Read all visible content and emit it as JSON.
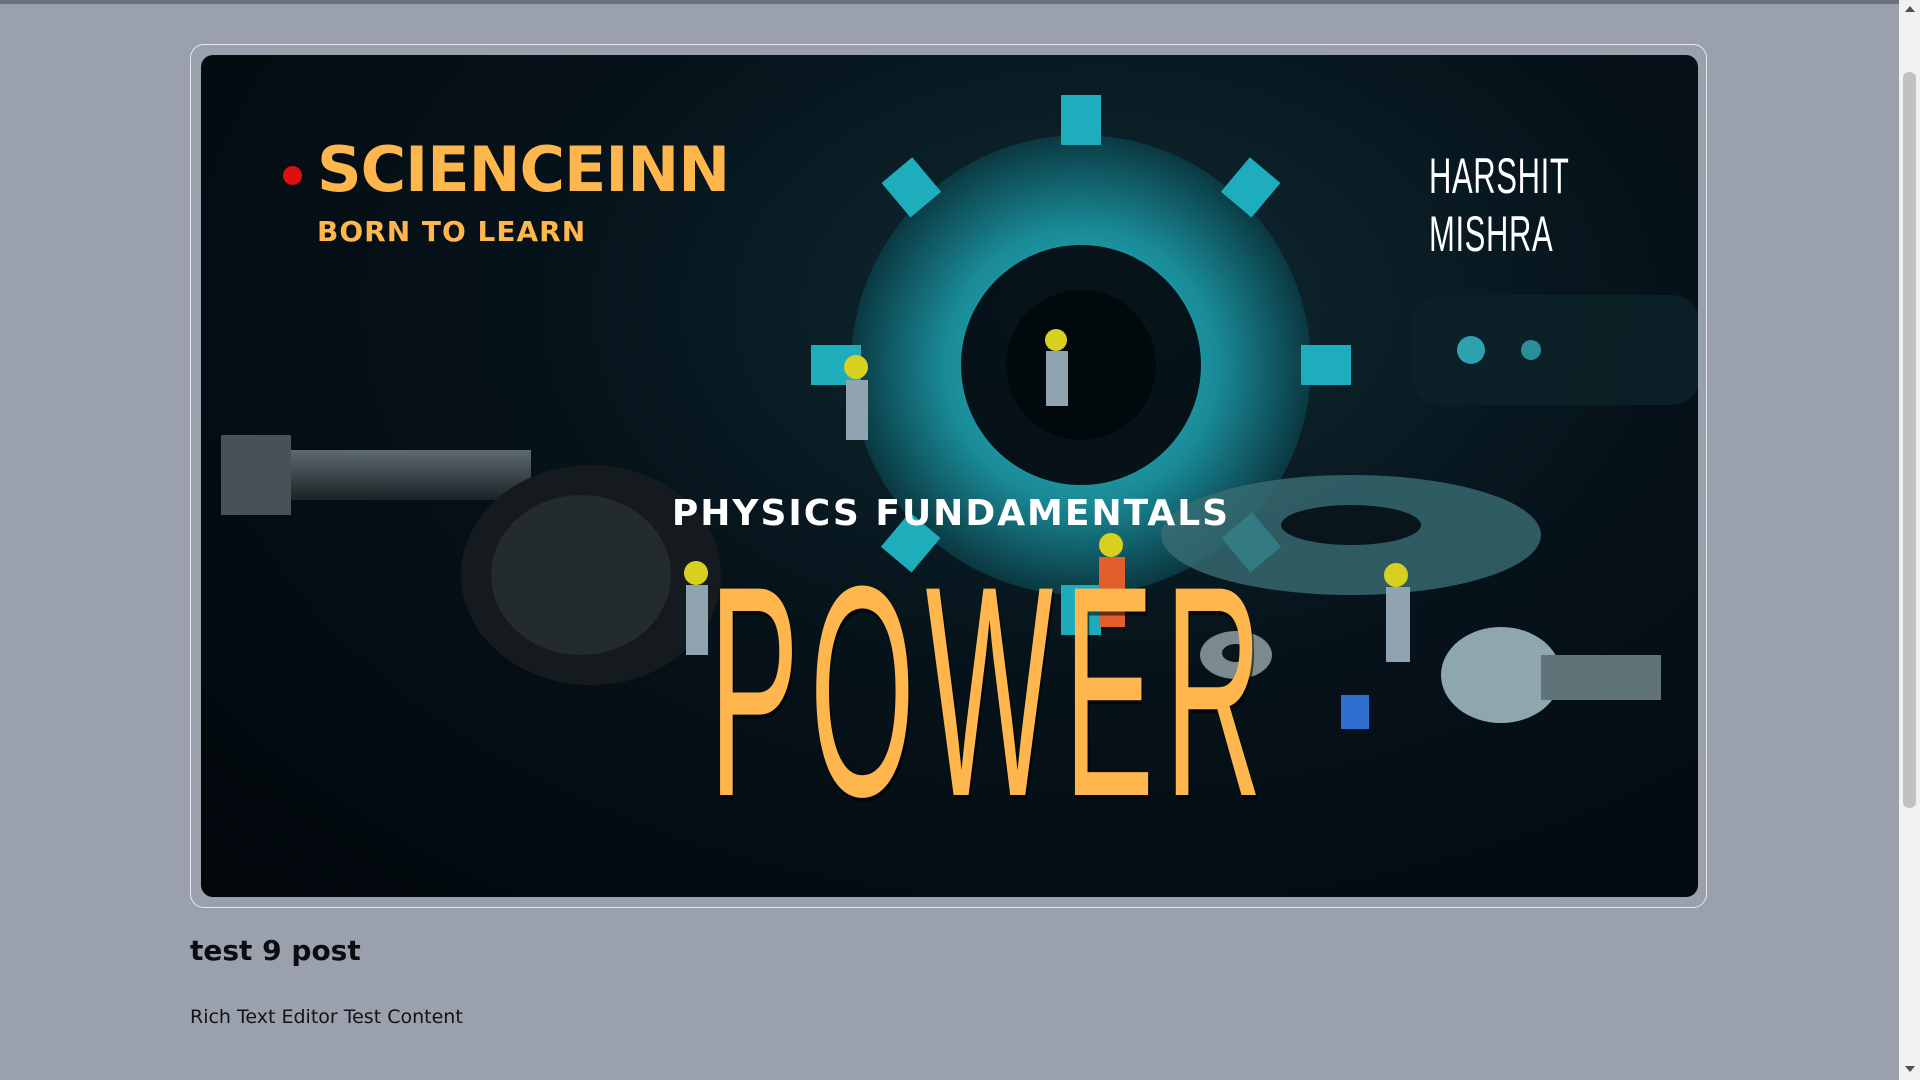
{
  "banner": {
    "brand_name": "SCIENCEINN",
    "brand_tagline": "BORN TO LEARN",
    "author": "HARSHIT MISHRA",
    "subtitle": "PHYSICS FUNDAMENTALS",
    "headline": "POWER",
    "accent_color": "#ffb64d",
    "dot_color": "#e00f0f"
  },
  "post": {
    "title": "test 9 post",
    "body": "Rich Text Editor Test Content"
  },
  "icons": {
    "scroll_up": "chevron-up-icon",
    "scroll_down": "chevron-down-icon"
  }
}
